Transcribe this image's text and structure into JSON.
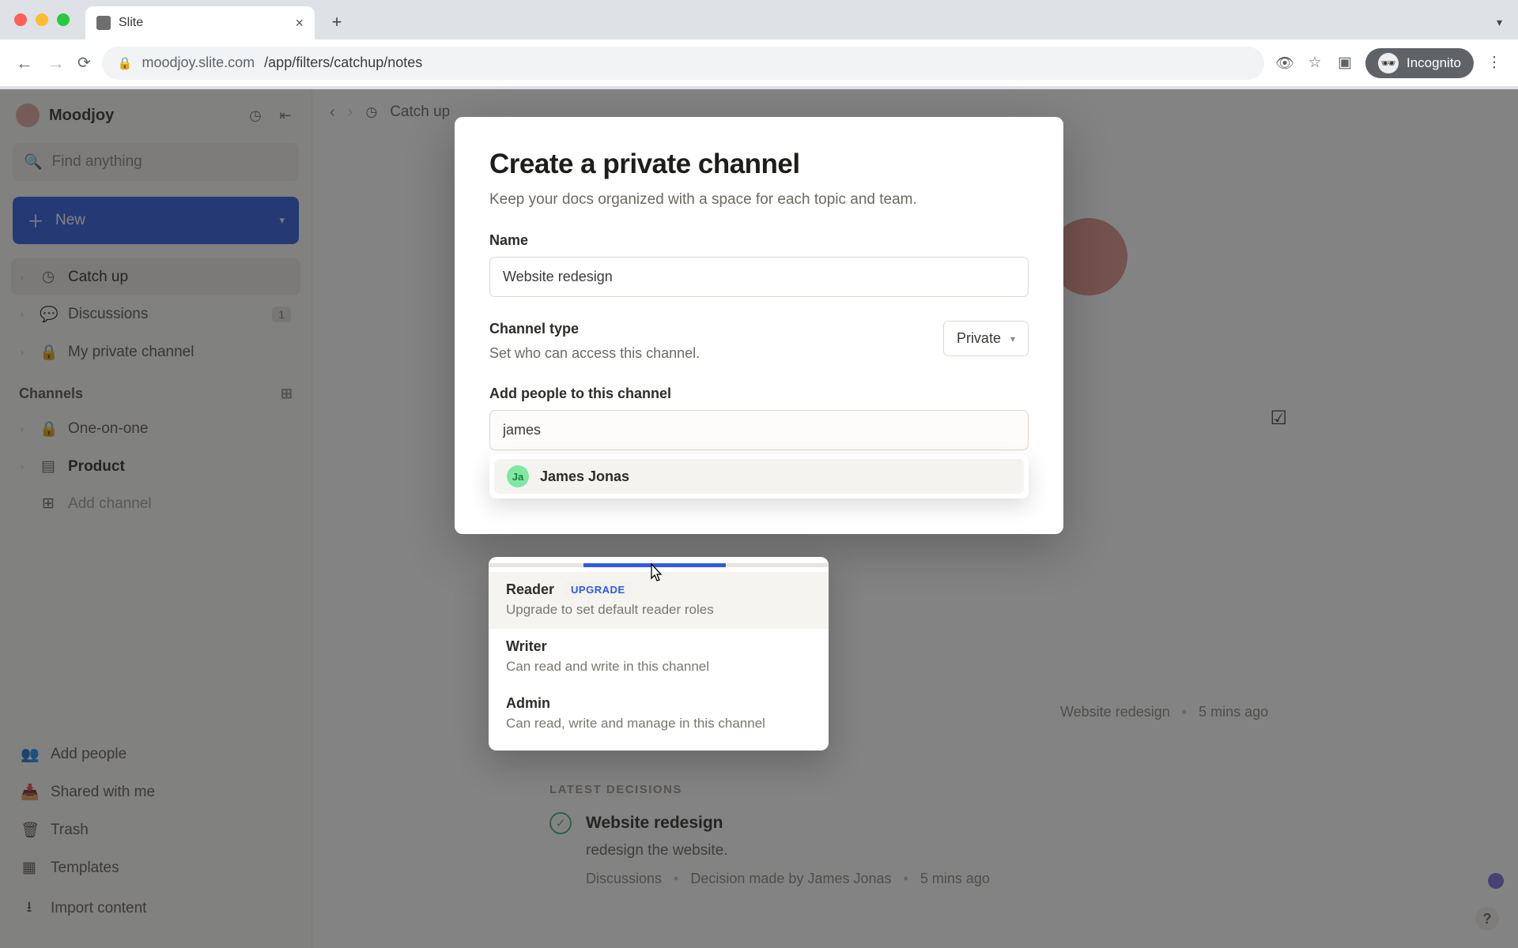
{
  "browser": {
    "tab_title": "Slite",
    "url_host": "moodjoy.slite.com",
    "url_path": "/app/filters/catchup/notes",
    "incognito_label": "Incognito"
  },
  "workspace": {
    "name": "Moodjoy"
  },
  "search": {
    "placeholder": "Find anything"
  },
  "new_button": {
    "label": "New"
  },
  "nav": {
    "catchup": "Catch up",
    "discussions": "Discussions",
    "discussions_badge": "1",
    "my_private": "My private channel"
  },
  "channels": {
    "header": "Channels",
    "one_on_one": "One-on-one",
    "product": "Product",
    "add_channel": "Add channel"
  },
  "footer": {
    "add_people": "Add people",
    "shared": "Shared with me",
    "trash": "Trash",
    "templates": "Templates",
    "import": "Import content"
  },
  "topbar": {
    "breadcrumb": "Catch up"
  },
  "modal": {
    "title": "Create a private channel",
    "subtitle": "Keep your docs organized with a space for each topic and team.",
    "name_label": "Name",
    "name_value": "Website redesign",
    "channel_type_label": "Channel type",
    "channel_type_desc": "Set who can access this channel.",
    "channel_type_value": "Private",
    "add_people_label": "Add people to this channel",
    "people_value": "james",
    "suggestion": {
      "initials": "Ja",
      "name": "James Jonas"
    }
  },
  "roles": {
    "reader": {
      "title": "Reader",
      "upgrade": "UPGRADE",
      "desc": "Upgrade to set default reader roles"
    },
    "writer": {
      "title": "Writer",
      "desc": "Can read and write in this channel"
    },
    "admin": {
      "title": "Admin",
      "desc": "Can read, write and manage in this channel"
    }
  },
  "background_decision": {
    "section": "LATEST DECISIONS",
    "title": "Website redesign",
    "body": "redesign the website.",
    "source": "Discussions",
    "byline": "Decision made by James Jonas",
    "time": "5 mins ago",
    "upper_tail": "Website redesign",
    "upper_time": "5 mins ago"
  }
}
